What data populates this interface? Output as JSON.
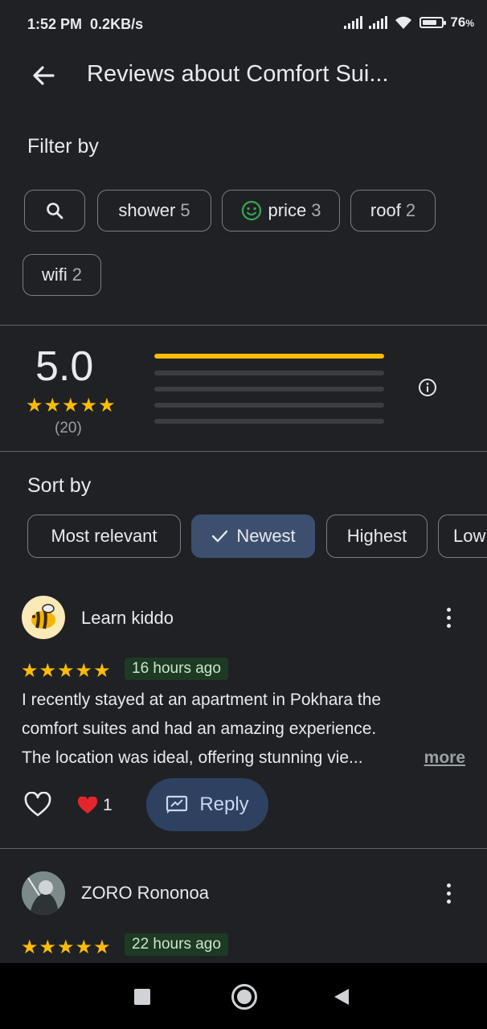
{
  "status_bar": {
    "time": "1:52 PM",
    "speed": "0.2KB/s",
    "battery_text": "76",
    "battery_unit": "%",
    "battery_level": 0.76
  },
  "header": {
    "title": "Reviews about Comfort Sui...",
    "back_icon": "arrow-back-icon"
  },
  "filter": {
    "label": "Filter by",
    "chips": [
      {
        "label": "shower",
        "count": "5"
      },
      {
        "label": "price",
        "count": "3"
      },
      {
        "label": "roof",
        "count": "2"
      },
      {
        "label": "wifi",
        "count": "2"
      }
    ]
  },
  "summary": {
    "score": "5.0",
    "stars": "★★★★★",
    "count": "(20)",
    "distribution": [
      1.0,
      0,
      0,
      0,
      0
    ],
    "accent": "#fbbc04"
  },
  "sort": {
    "label": "Sort by",
    "options": [
      "Most relevant",
      "Newest",
      "Highest",
      "Low"
    ],
    "selected": "Newest"
  },
  "reviews": [
    {
      "name": "Learn kiddo",
      "stars": "★★★★★",
      "time": "16 hours ago",
      "text_lines": [
        "I recently stayed at an apartment in Pokhara  the",
        "comfort suites and had an amazing experience.",
        "The location was ideal, offering stunning vie..."
      ],
      "more": "more",
      "likes": "1",
      "reply": "Reply"
    },
    {
      "name": "ZORO Rononoa",
      "stars": "★★★★★",
      "time": "22 hours ago"
    }
  ]
}
